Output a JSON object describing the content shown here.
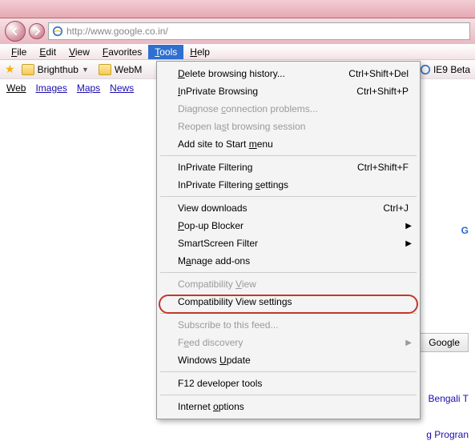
{
  "url": "http://www.google.co.in/",
  "menubar": [
    "File",
    "Edit",
    "View",
    "Favorites",
    "Tools",
    "Help"
  ],
  "menubar_selected_index": 4,
  "favbar": {
    "items": [
      "Brighthub",
      "WebM"
    ],
    "right": "IE9 Beta"
  },
  "linksrow": [
    "Web",
    "Images",
    "Maps",
    "News"
  ],
  "dropdown": [
    {
      "type": "item",
      "label": "Delete browsing history...",
      "u": "D",
      "sc": "Ctrl+Shift+Del"
    },
    {
      "type": "item",
      "label": "InPrivate Browsing",
      "u": "I",
      "sc": "Ctrl+Shift+P"
    },
    {
      "type": "item",
      "label": "Diagnose connection problems...",
      "u": "c",
      "disabled": true
    },
    {
      "type": "item",
      "label": "Reopen last browsing session",
      "u": "s",
      "disabled": true
    },
    {
      "type": "item",
      "label": "Add site to Start menu",
      "u": "m"
    },
    {
      "type": "sep"
    },
    {
      "type": "item",
      "label": "InPrivate Filtering",
      "u": "",
      "sc": "Ctrl+Shift+F"
    },
    {
      "type": "item",
      "label": "InPrivate Filtering settings",
      "u": "s"
    },
    {
      "type": "sep"
    },
    {
      "type": "item",
      "label": "View downloads",
      "u": "",
      "sc": "Ctrl+J"
    },
    {
      "type": "item",
      "label": "Pop-up Blocker",
      "u": "P",
      "submenu": true
    },
    {
      "type": "item",
      "label": "SmartScreen Filter",
      "u": "",
      "submenu": true
    },
    {
      "type": "item",
      "label": "Manage add-ons",
      "u": "a"
    },
    {
      "type": "sep"
    },
    {
      "type": "item",
      "label": "Compatibility View",
      "u": "V",
      "disabled": true
    },
    {
      "type": "item",
      "label": "Compatibility View settings",
      "u": "",
      "highlight": true
    },
    {
      "type": "sep"
    },
    {
      "type": "item",
      "label": "Subscribe to this feed...",
      "u": "",
      "disabled": true
    },
    {
      "type": "item",
      "label": "Feed discovery",
      "u": "e",
      "disabled": true,
      "submenu": true
    },
    {
      "type": "item",
      "label": "Windows Update",
      "u": "U"
    },
    {
      "type": "sep"
    },
    {
      "type": "item",
      "label": "F12 developer tools",
      "u": ""
    },
    {
      "type": "sep"
    },
    {
      "type": "item",
      "label": "Internet options",
      "u": "o"
    }
  ],
  "search_button": "Google",
  "lang_links": "Bengali  T",
  "prog_links": "g Progran",
  "logo_char": "G"
}
